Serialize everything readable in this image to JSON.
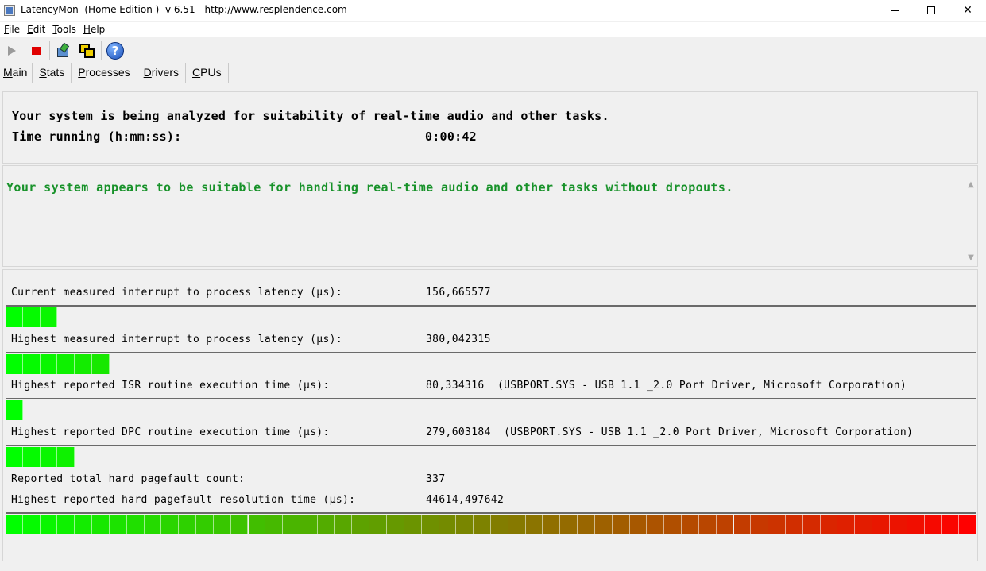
{
  "window": {
    "title": "LatencyMon  (Home Edition )  v 6.51 - http://www.resplendence.com",
    "minimize_glyph": "",
    "maximize_glyph": "",
    "close_glyph": "✕"
  },
  "menu": {
    "file": {
      "accel": "F",
      "rest": "ile"
    },
    "edit": {
      "accel": "E",
      "rest": "dit"
    },
    "tools": {
      "accel": "T",
      "rest": "ools"
    },
    "help": {
      "accel": "H",
      "rest": "elp"
    }
  },
  "toolbar": {
    "icons": [
      "play-icon",
      "stop-icon",
      "tools-icon",
      "windows-icon",
      "help-icon"
    ],
    "help_glyph": "?"
  },
  "tabs": [
    {
      "accel": "M",
      "rest": "ain",
      "active": true
    },
    {
      "accel": "S",
      "rest": "tats"
    },
    {
      "accel": "P",
      "rest": "rocesses"
    },
    {
      "accel": "D",
      "rest": "rivers"
    },
    {
      "accel": "C",
      "rest": "PUs"
    }
  ],
  "status": {
    "analyzing_text": "Your system is being analyzed for suitability of real-time audio and other tasks.",
    "time_label": "Time running (h:mm:ss):",
    "time_value": "0:00:42"
  },
  "verdict": {
    "message": "Your system appears to be suitable for handling real-time audio and other tasks without dropouts.",
    "color": "#18922a"
  },
  "measurements": [
    {
      "label": "Current measured interrupt to process latency (µs):",
      "value": "156,665577",
      "segments": 3
    },
    {
      "label": "Highest measured interrupt to process latency (µs):",
      "value": "380,042315",
      "segments": 6
    },
    {
      "label": "Highest reported ISR routine execution time (µs):",
      "value": "80,334316  (USBPORT.SYS - USB 1.1 _2.0 Port Driver, Microsoft Corporation)",
      "segments": 1
    },
    {
      "label": "Highest reported DPC routine execution time (µs):",
      "value": "279,603184  (USBPORT.SYS - USB 1.1 _2.0 Port Driver, Microsoft Corporation)",
      "segments": 4
    },
    {
      "label": "Reported total hard pagefault count:",
      "value": "337"
    },
    {
      "label": "Highest reported hard pagefault resolution time (µs):",
      "value": "44614,497642",
      "segments": 56
    }
  ],
  "meter": {
    "total_segments": 56,
    "start_color": "#00ff00",
    "end_color": "#ff0000"
  }
}
